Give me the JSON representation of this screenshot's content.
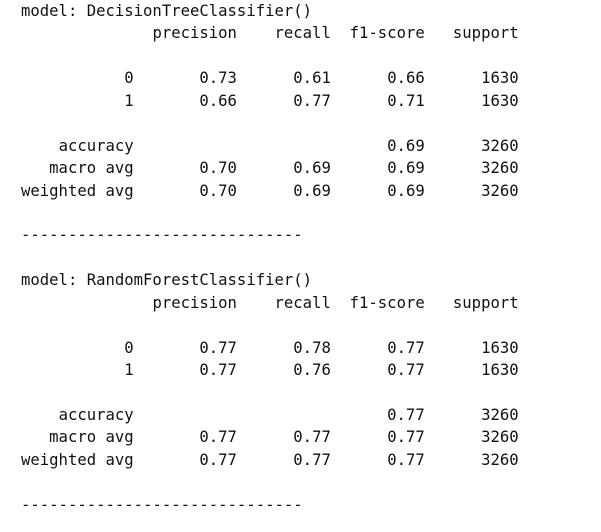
{
  "reports": [
    {
      "model_line": "model: DecisionTreeClassifier()",
      "header": {
        "precision": "precision",
        "recall": "recall",
        "f1": "f1-score",
        "support": "support"
      },
      "class_rows": [
        {
          "label": "0",
          "precision": "0.73",
          "recall": "0.61",
          "f1": "0.66",
          "support": "1630"
        },
        {
          "label": "1",
          "precision": "0.66",
          "recall": "0.77",
          "f1": "0.71",
          "support": "1630"
        }
      ],
      "accuracy": {
        "label": "accuracy",
        "f1": "0.69",
        "support": "3260"
      },
      "macro_avg": {
        "label": "macro avg",
        "precision": "0.70",
        "recall": "0.69",
        "f1": "0.69",
        "support": "3260"
      },
      "weighted_avg": {
        "label": "weighted avg",
        "precision": "0.70",
        "recall": "0.69",
        "f1": "0.69",
        "support": "3260"
      },
      "separator": "------------------------------"
    },
    {
      "model_line": "model: RandomForestClassifier()",
      "header": {
        "precision": "precision",
        "recall": "recall",
        "f1": "f1-score",
        "support": "support"
      },
      "class_rows": [
        {
          "label": "0",
          "precision": "0.77",
          "recall": "0.78",
          "f1": "0.77",
          "support": "1630"
        },
        {
          "label": "1",
          "precision": "0.77",
          "recall": "0.76",
          "f1": "0.77",
          "support": "1630"
        }
      ],
      "accuracy": {
        "label": "accuracy",
        "f1": "0.77",
        "support": "3260"
      },
      "macro_avg": {
        "label": "macro avg",
        "precision": "0.77",
        "recall": "0.77",
        "f1": "0.77",
        "support": "3260"
      },
      "weighted_avg": {
        "label": "weighted avg",
        "precision": "0.77",
        "recall": "0.77",
        "f1": "0.77",
        "support": "3260"
      },
      "separator": "------------------------------"
    }
  ]
}
